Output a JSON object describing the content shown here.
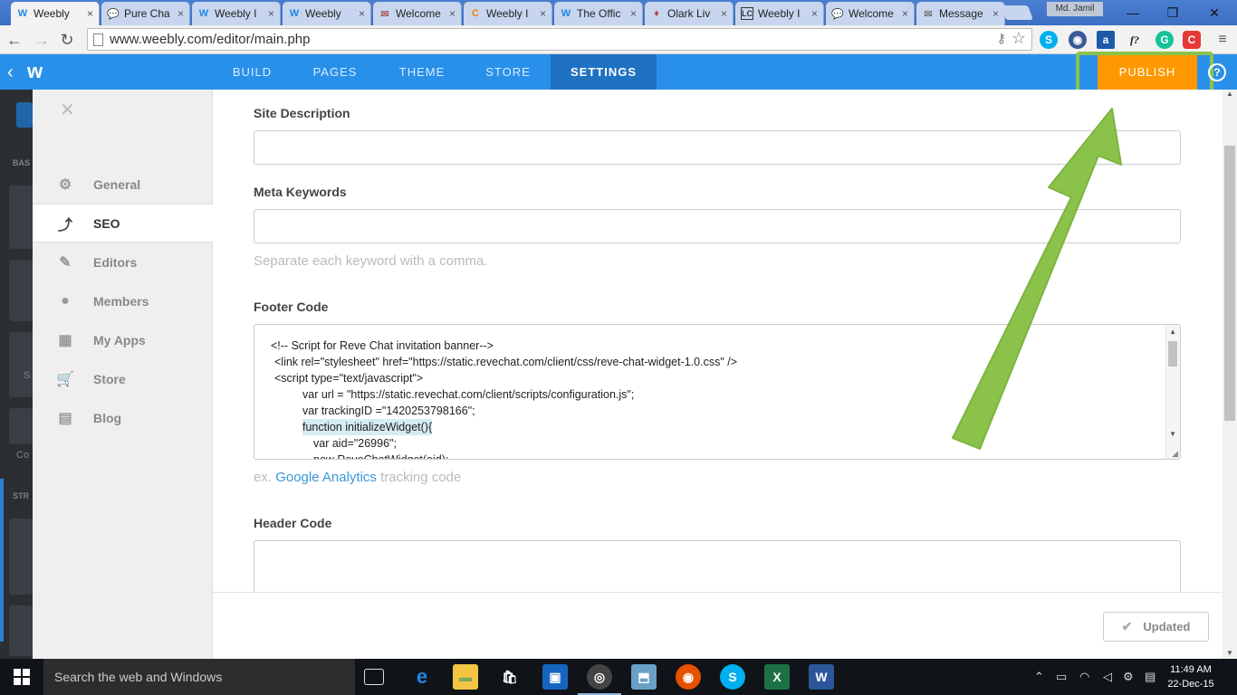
{
  "browser": {
    "tabs": [
      {
        "label": "Weebly",
        "icon": "W",
        "active": true
      },
      {
        "label": "Pure Cha",
        "icon": "💬"
      },
      {
        "label": "Weebly I",
        "icon": "W"
      },
      {
        "label": "Weebly",
        "icon": "W"
      },
      {
        "label": "Welcome",
        "icon": "✉"
      },
      {
        "label": "Weebly I",
        "icon": "C"
      },
      {
        "label": "The Offic",
        "icon": "W"
      },
      {
        "label": "Olark Liv",
        "icon": "♦"
      },
      {
        "label": "Weebly I",
        "icon": "LC"
      },
      {
        "label": "Welcome",
        "icon": "💬"
      },
      {
        "label": "Message",
        "icon": "✉"
      }
    ],
    "user": "Md. Jamil",
    "url": "www.weebly.com/editor/main.php"
  },
  "weebly": {
    "nav": [
      "BUILD",
      "PAGES",
      "THEME",
      "STORE",
      "SETTINGS"
    ],
    "active_nav": "SETTINGS",
    "publish": "PUBLISH",
    "help": "?"
  },
  "sidebar": {
    "items": [
      {
        "label": "General",
        "icon": "gear-icon"
      },
      {
        "label": "SEO",
        "icon": "trend-icon",
        "active": true
      },
      {
        "label": "Editors",
        "icon": "pencil-icon"
      },
      {
        "label": "Members",
        "icon": "person-icon"
      },
      {
        "label": "My Apps",
        "icon": "grid-icon"
      },
      {
        "label": "Store",
        "icon": "cart-icon"
      },
      {
        "label": "Blog",
        "icon": "comment-icon"
      }
    ]
  },
  "darkpanel": {
    "label1": "BAS",
    "label2": "STR",
    "label3": "Co",
    "label4": "S"
  },
  "form": {
    "site_description_label": "Site Description",
    "site_description_value": "",
    "meta_keywords_label": "Meta Keywords",
    "meta_keywords_value": "",
    "meta_keywords_hint": "Separate each keyword with a comma.",
    "footer_code_label": "Footer Code",
    "footer_code_lines": [
      "<!-- Script for Reve Chat invitation banner-->",
      "<link rel=\"stylesheet\" href=\"https://static.revechat.com/client/css/reve-chat-widget-1.0.css\" />",
      "<script type=\"text/javascript\">",
      "var url = \"https://static.revechat.com/client/scripts/configuration.js\";",
      "var trackingID =\"1420253798166\";",
      "function initializeWidget(){",
      "var aid=\"26996\";",
      "new ReveChatWidget(aid);"
    ],
    "footer_hint_prefix": "ex.",
    "footer_hint_link": "Google Analytics",
    "footer_hint_suffix": "tracking code",
    "header_code_label": "Header Code",
    "header_code_value": ""
  },
  "status": {
    "updated": "Updated"
  },
  "taskbar": {
    "search_placeholder": "Search the web and Windows",
    "time": "11:49 AM",
    "date": "22-Dec-15"
  },
  "colors": {
    "accent": "#2990ea",
    "publish": "#ff9800",
    "annotation": "#8bc34a"
  }
}
